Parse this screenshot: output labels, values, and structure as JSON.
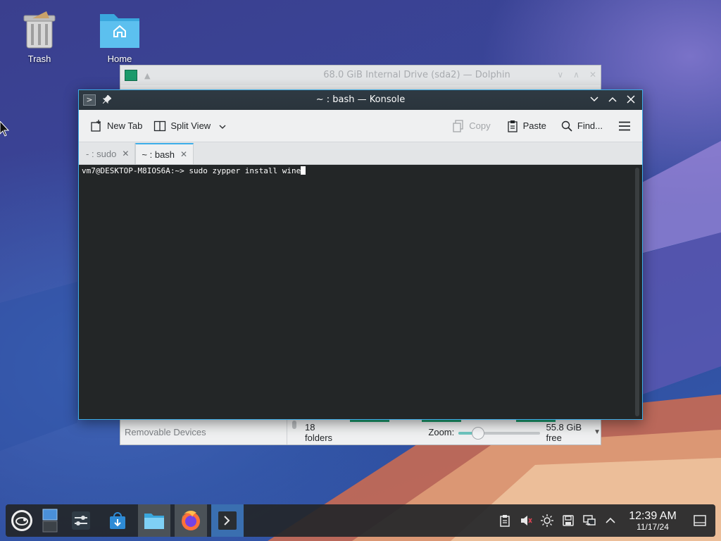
{
  "desktop": {
    "icons": [
      {
        "label": "Trash",
        "icon": "trash-icon"
      },
      {
        "label": "Home",
        "icon": "home-folder-icon"
      }
    ]
  },
  "dolphin": {
    "title": "68.0 GiB Internal Drive (sda2) — Dolphin",
    "sidebar_bottom_label": "Removable Devices",
    "status": {
      "folders": "18 folders",
      "zoom_label": "Zoom:",
      "zoom_level": 0.2,
      "free_space": "55.8 GiB free"
    }
  },
  "konsole": {
    "title": "~ : bash — Konsole",
    "toolbar": {
      "new_tab": "New Tab",
      "split_view": "Split View",
      "copy": "Copy",
      "paste": "Paste",
      "find": "Find..."
    },
    "tabs": [
      {
        "label": "- : sudo",
        "active": false
      },
      {
        "label": "~ : bash",
        "active": true
      }
    ],
    "terminal": {
      "prompt": "vm7@DESKTOP-M8IOS6A:~>",
      "command": " sudo zypper install wine"
    }
  },
  "taskbar": {
    "items": [
      "opensuse-launcher-icon",
      "pager-icon",
      "system-settings-icon",
      "discover-icon",
      "dolphin-icon",
      "firefox-icon",
      "konsole-icon"
    ],
    "clock": {
      "time": "12:39 AM",
      "date": "11/17/24"
    }
  },
  "colors": {
    "accent": "#3daee9",
    "dolphin_green": "#1b9a6b",
    "terminal_bg": "#232627",
    "taskbar_bg": "#232629"
  }
}
